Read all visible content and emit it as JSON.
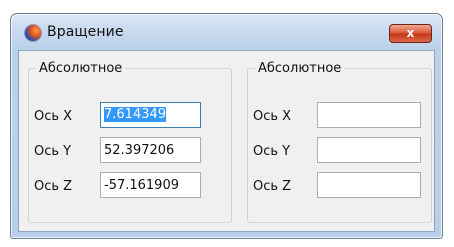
{
  "window": {
    "title": "Вращение",
    "close_label": "x"
  },
  "groups": [
    {
      "label": "Абсолютное",
      "axes": [
        {
          "label": "Ось X",
          "value": "7.614349",
          "selected": true
        },
        {
          "label": "Ось Y",
          "value": "52.397206"
        },
        {
          "label": "Ось Z",
          "value": "-57.161909"
        }
      ]
    },
    {
      "label": "Абсолютное",
      "axes": [
        {
          "label": "Ось X",
          "value": ""
        },
        {
          "label": "Ось Y",
          "value": ""
        },
        {
          "label": "Ось Z",
          "value": ""
        }
      ]
    }
  ],
  "colors": {
    "titlebar": "#c7d9ee",
    "close_button": "#c53416",
    "selection": "#3399ff",
    "client_bg": "#f0f0f0"
  },
  "icons": {
    "app": "globe-icon",
    "close": "close-icon"
  }
}
